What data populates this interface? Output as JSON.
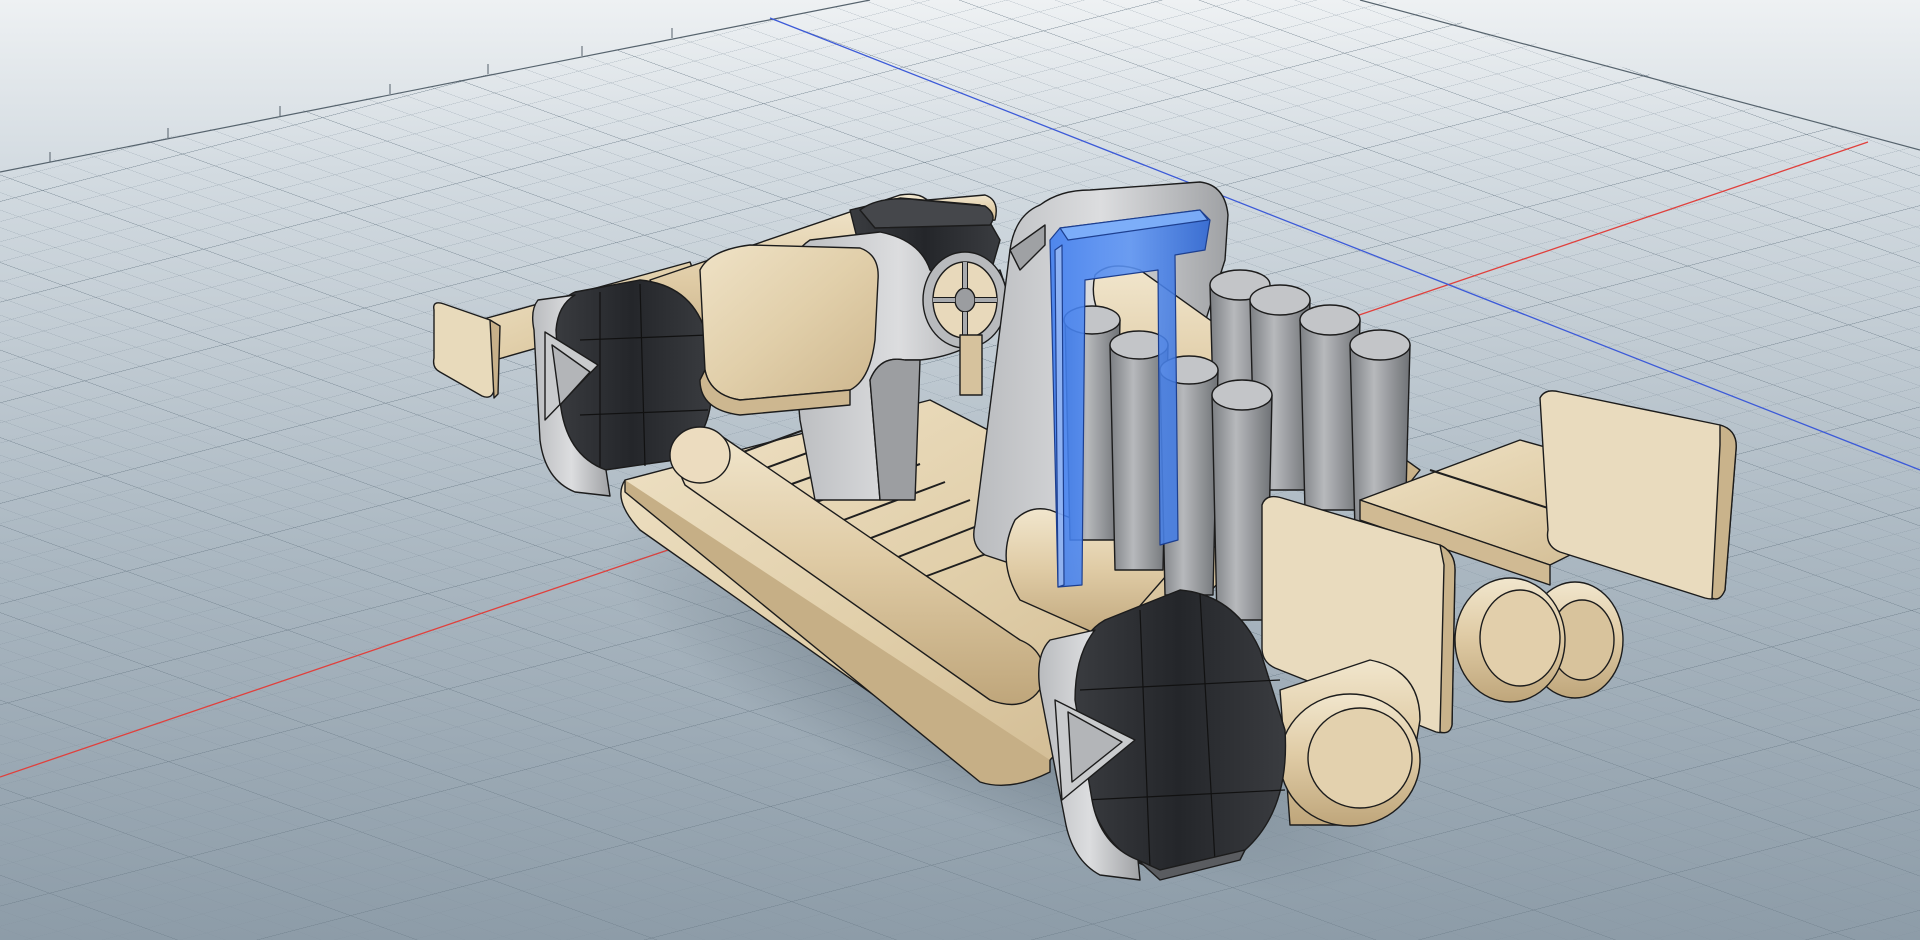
{
  "viewport": {
    "background_top": "#e4e9ed",
    "background_bottom": "#9aa8b3",
    "grid_color": "#7d8d99",
    "axis_x_color": "#e0403c",
    "axis_z_color": "#3c5ad8",
    "selection_color": "#2f6fe0"
  },
  "ruler": {
    "tick_labels": [
      "",
      "",
      "",
      "",
      "",
      "",
      ""
    ]
  },
  "model": {
    "materials": {
      "wood": "#e3d3b4",
      "wood_dark": "#c9b48f",
      "metal": "#9a9c9f",
      "metal_light": "#c7c9cb",
      "tire": "#2e3034"
    },
    "selected_part": "roll-bar"
  }
}
